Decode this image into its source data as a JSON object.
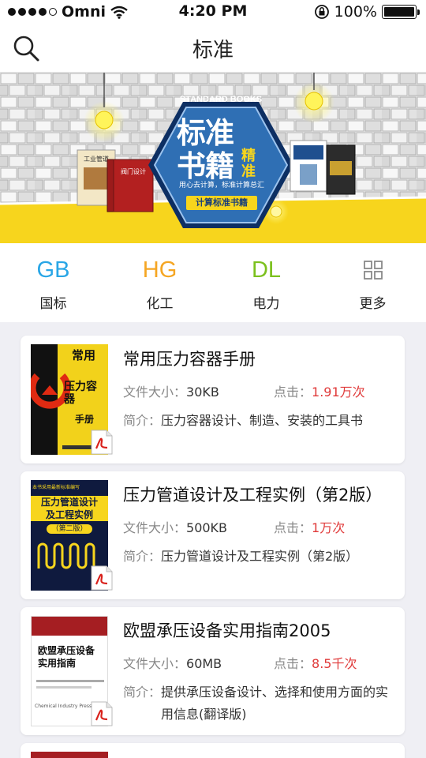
{
  "status_bar": {
    "carrier": "Omni",
    "time": "4:20 PM",
    "battery": "100%"
  },
  "nav": {
    "title": "标准"
  },
  "banner": {
    "heading_en": "STANDARD BOOKS",
    "heading_line1": "标准",
    "heading_line2": "书籍",
    "heading_tag": "精准",
    "slogan": "用心去计算，标准计算总汇",
    "ribbon": "计算标准书籍"
  },
  "categories": [
    {
      "code": "GB",
      "label": "国标",
      "color": "#29a6e6"
    },
    {
      "code": "HG",
      "label": "化工",
      "color": "#f5a623"
    },
    {
      "code": "DL",
      "label": "电力",
      "color": "#7cc11e"
    },
    {
      "code": "",
      "label": "更多",
      "color": "#888888"
    }
  ],
  "books": [
    {
      "title": "常用压力容器手册",
      "size_label": "文件大小：",
      "size": "30KB",
      "clicks_label": "点击：",
      "clicks": "1.91万次",
      "intro_label": "简介：",
      "intro": "压力容器设计、制造、安装的工具书"
    },
    {
      "title": "压力管道设计及工程实例（第2版）",
      "size_label": "文件大小：",
      "size": "500KB",
      "clicks_label": "点击：",
      "clicks": "1万次",
      "intro_label": "简介：",
      "intro": "压力管道设计及工程实例（第2版）"
    },
    {
      "title": "欧盟承压设备实用指南2005",
      "size_label": "文件大小：",
      "size": "60MB",
      "clicks_label": "点击：",
      "clicks": "8.5千次",
      "intro_label": "简介：",
      "intro": "提供承压设备设计、选择和使用方面的实用信息(翻译版)"
    }
  ],
  "covers": {
    "book1": {
      "title_a": "常用",
      "title_b": "压力容器",
      "title_c": "手册"
    },
    "book2": {
      "top": "本书采用最新标准编写",
      "title_a": "压力管道设计",
      "title_b": "及工程实例",
      "edition": "（第二版）"
    },
    "book3": {
      "title_a": "欧盟承压设备",
      "title_b": "实用指南",
      "publisher": "Chemical Industry Press"
    }
  },
  "colors": {
    "accent_red": "#e03a3a",
    "banner_blue": "#2f6fb4",
    "banner_yellow": "#f7d51d"
  }
}
